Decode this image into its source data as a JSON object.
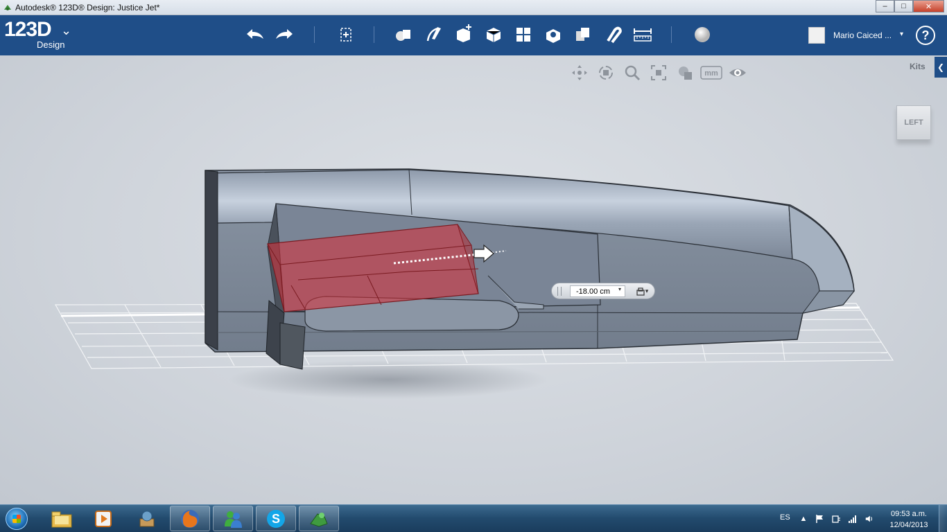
{
  "window": {
    "title": "Autodesk® 123D® Design: Justice Jet*",
    "minimize": "–",
    "maximize": "□",
    "close": "✕"
  },
  "app": {
    "logo_number": "123D",
    "logo_sub": "Design",
    "logo_menu_glyph": "⌄"
  },
  "toolbar": {
    "icons": [
      "undo-icon",
      "redo-icon",
      "transform-icon",
      "primitives-icon",
      "sketch-icon",
      "construct-icon",
      "modify-icon",
      "pattern-icon",
      "grouping-icon",
      "combine-icon",
      "snap-icon",
      "measure-icon",
      "material-icon"
    ]
  },
  "user": {
    "name": "Mario Caiced ...",
    "dropdown": "▾",
    "help": "?"
  },
  "viewport": {
    "kits_label": "Kits",
    "kits_arrow": "❮",
    "viewcube_label": "LEFT",
    "units_label": "mm",
    "nav_icons": [
      "pan-icon",
      "orbit-icon",
      "zoom-icon",
      "fit-icon",
      "view-style-icon",
      "units-icon",
      "visibility-icon"
    ]
  },
  "dimension": {
    "value": "-18.00 cm",
    "dropdown": "▾",
    "snap_dropdown": "▾"
  },
  "taskbar": {
    "apps": [
      "explorer-icon",
      "media-player-icon",
      "games-icon",
      "firefox-icon",
      "messenger-icon",
      "skype-icon",
      "123d-design-icon"
    ],
    "language": "ES",
    "time": "09:53 a.m.",
    "date": "12/04/2013"
  },
  "colors": {
    "appbar": "#1f4e88",
    "selection_red": "#c8323c",
    "model_body": "#7f8a98"
  }
}
